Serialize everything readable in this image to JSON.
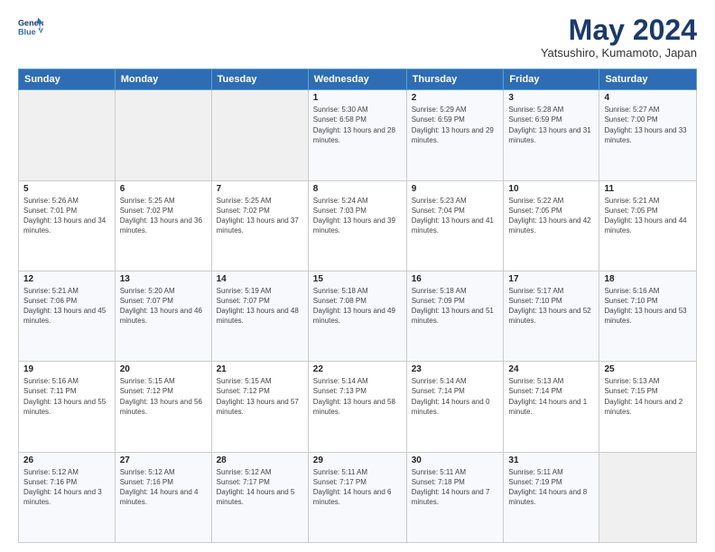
{
  "logo": {
    "line1": "General",
    "line2": "Blue"
  },
  "title": "May 2024",
  "subtitle": "Yatsushiro, Kumamoto, Japan",
  "days_of_week": [
    "Sunday",
    "Monday",
    "Tuesday",
    "Wednesday",
    "Thursday",
    "Friday",
    "Saturday"
  ],
  "weeks": [
    [
      {
        "day": "",
        "empty": true
      },
      {
        "day": "",
        "empty": true
      },
      {
        "day": "",
        "empty": true
      },
      {
        "day": "1",
        "sunrise": "5:30 AM",
        "sunset": "6:58 PM",
        "daylight": "13 hours and 28 minutes."
      },
      {
        "day": "2",
        "sunrise": "5:29 AM",
        "sunset": "6:59 PM",
        "daylight": "13 hours and 29 minutes."
      },
      {
        "day": "3",
        "sunrise": "5:28 AM",
        "sunset": "6:59 PM",
        "daylight": "13 hours and 31 minutes."
      },
      {
        "day": "4",
        "sunrise": "5:27 AM",
        "sunset": "7:00 PM",
        "daylight": "13 hours and 33 minutes."
      }
    ],
    [
      {
        "day": "5",
        "sunrise": "5:26 AM",
        "sunset": "7:01 PM",
        "daylight": "13 hours and 34 minutes."
      },
      {
        "day": "6",
        "sunrise": "5:25 AM",
        "sunset": "7:02 PM",
        "daylight": "13 hours and 36 minutes."
      },
      {
        "day": "7",
        "sunrise": "5:25 AM",
        "sunset": "7:02 PM",
        "daylight": "13 hours and 37 minutes."
      },
      {
        "day": "8",
        "sunrise": "5:24 AM",
        "sunset": "7:03 PM",
        "daylight": "13 hours and 39 minutes."
      },
      {
        "day": "9",
        "sunrise": "5:23 AM",
        "sunset": "7:04 PM",
        "daylight": "13 hours and 41 minutes."
      },
      {
        "day": "10",
        "sunrise": "5:22 AM",
        "sunset": "7:05 PM",
        "daylight": "13 hours and 42 minutes."
      },
      {
        "day": "11",
        "sunrise": "5:21 AM",
        "sunset": "7:05 PM",
        "daylight": "13 hours and 44 minutes."
      }
    ],
    [
      {
        "day": "12",
        "sunrise": "5:21 AM",
        "sunset": "7:06 PM",
        "daylight": "13 hours and 45 minutes."
      },
      {
        "day": "13",
        "sunrise": "5:20 AM",
        "sunset": "7:07 PM",
        "daylight": "13 hours and 46 minutes."
      },
      {
        "day": "14",
        "sunrise": "5:19 AM",
        "sunset": "7:07 PM",
        "daylight": "13 hours and 48 minutes."
      },
      {
        "day": "15",
        "sunrise": "5:18 AM",
        "sunset": "7:08 PM",
        "daylight": "13 hours and 49 minutes."
      },
      {
        "day": "16",
        "sunrise": "5:18 AM",
        "sunset": "7:09 PM",
        "daylight": "13 hours and 51 minutes."
      },
      {
        "day": "17",
        "sunrise": "5:17 AM",
        "sunset": "7:10 PM",
        "daylight": "13 hours and 52 minutes."
      },
      {
        "day": "18",
        "sunrise": "5:16 AM",
        "sunset": "7:10 PM",
        "daylight": "13 hours and 53 minutes."
      }
    ],
    [
      {
        "day": "19",
        "sunrise": "5:16 AM",
        "sunset": "7:11 PM",
        "daylight": "13 hours and 55 minutes."
      },
      {
        "day": "20",
        "sunrise": "5:15 AM",
        "sunset": "7:12 PM",
        "daylight": "13 hours and 56 minutes."
      },
      {
        "day": "21",
        "sunrise": "5:15 AM",
        "sunset": "7:12 PM",
        "daylight": "13 hours and 57 minutes."
      },
      {
        "day": "22",
        "sunrise": "5:14 AM",
        "sunset": "7:13 PM",
        "daylight": "13 hours and 58 minutes."
      },
      {
        "day": "23",
        "sunrise": "5:14 AM",
        "sunset": "7:14 PM",
        "daylight": "14 hours and 0 minutes."
      },
      {
        "day": "24",
        "sunrise": "5:13 AM",
        "sunset": "7:14 PM",
        "daylight": "14 hours and 1 minute."
      },
      {
        "day": "25",
        "sunrise": "5:13 AM",
        "sunset": "7:15 PM",
        "daylight": "14 hours and 2 minutes."
      }
    ],
    [
      {
        "day": "26",
        "sunrise": "5:12 AM",
        "sunset": "7:16 PM",
        "daylight": "14 hours and 3 minutes."
      },
      {
        "day": "27",
        "sunrise": "5:12 AM",
        "sunset": "7:16 PM",
        "daylight": "14 hours and 4 minutes."
      },
      {
        "day": "28",
        "sunrise": "5:12 AM",
        "sunset": "7:17 PM",
        "daylight": "14 hours and 5 minutes."
      },
      {
        "day": "29",
        "sunrise": "5:11 AM",
        "sunset": "7:17 PM",
        "daylight": "14 hours and 6 minutes."
      },
      {
        "day": "30",
        "sunrise": "5:11 AM",
        "sunset": "7:18 PM",
        "daylight": "14 hours and 7 minutes."
      },
      {
        "day": "31",
        "sunrise": "5:11 AM",
        "sunset": "7:19 PM",
        "daylight": "14 hours and 8 minutes."
      },
      {
        "day": "",
        "empty": true
      }
    ]
  ]
}
